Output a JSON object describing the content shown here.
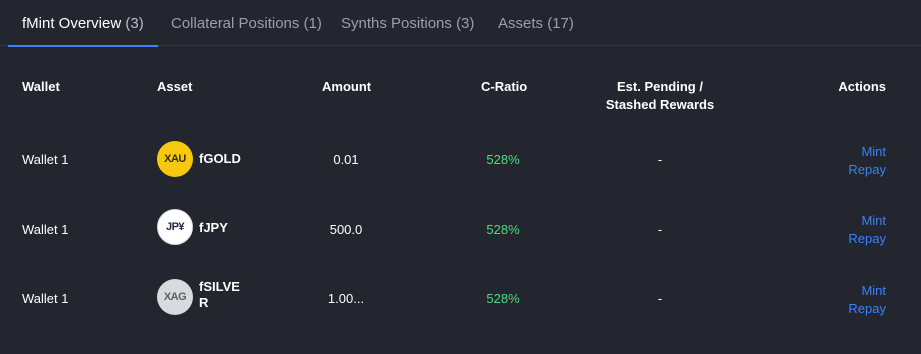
{
  "tabs": [
    {
      "label": "fMint Overview",
      "count": "(3)",
      "active": true
    },
    {
      "label": "Collateral Positions",
      "count": "(1)"
    },
    {
      "label": "Synths Positions",
      "count": "(3)"
    },
    {
      "label": "Assets",
      "count": "(17)"
    }
  ],
  "table": {
    "headers": {
      "wallet": "Wallet",
      "asset": "Asset",
      "amount": "Amount",
      "cratio": "C-Ratio",
      "rewards_line1": "Est. Pending /",
      "rewards_line2": "Stashed Rewards",
      "actions": "Actions"
    },
    "rows": [
      {
        "wallet": "Wallet 1",
        "icon_text": "XAU",
        "icon": "gold-coin-icon",
        "asset_line1": "fGOLD",
        "asset_line2": "",
        "amount": "0.01",
        "cratio": "528%",
        "rewards": "-",
        "action1": "Mint",
        "action2": "Repay"
      },
      {
        "wallet": "Wallet 1",
        "icon_text": "JP¥",
        "icon": "yen-coin-icon",
        "asset_line1": "fJPY",
        "asset_line2": "",
        "amount": "500.0",
        "cratio": "528%",
        "rewards": "-",
        "action1": "Mint",
        "action2": "Repay"
      },
      {
        "wallet": "Wallet 1",
        "icon_text": "XAG",
        "icon": "silver-coin-icon",
        "asset_line1": "fSILVE",
        "asset_line2": "R",
        "amount": "1.00...",
        "cratio": "528%",
        "rewards": "-",
        "action1": "Mint",
        "action2": "Repay"
      }
    ]
  },
  "colors": {
    "background": "#23252f",
    "accent": "#3b82f6",
    "positive": "#4ade80"
  }
}
